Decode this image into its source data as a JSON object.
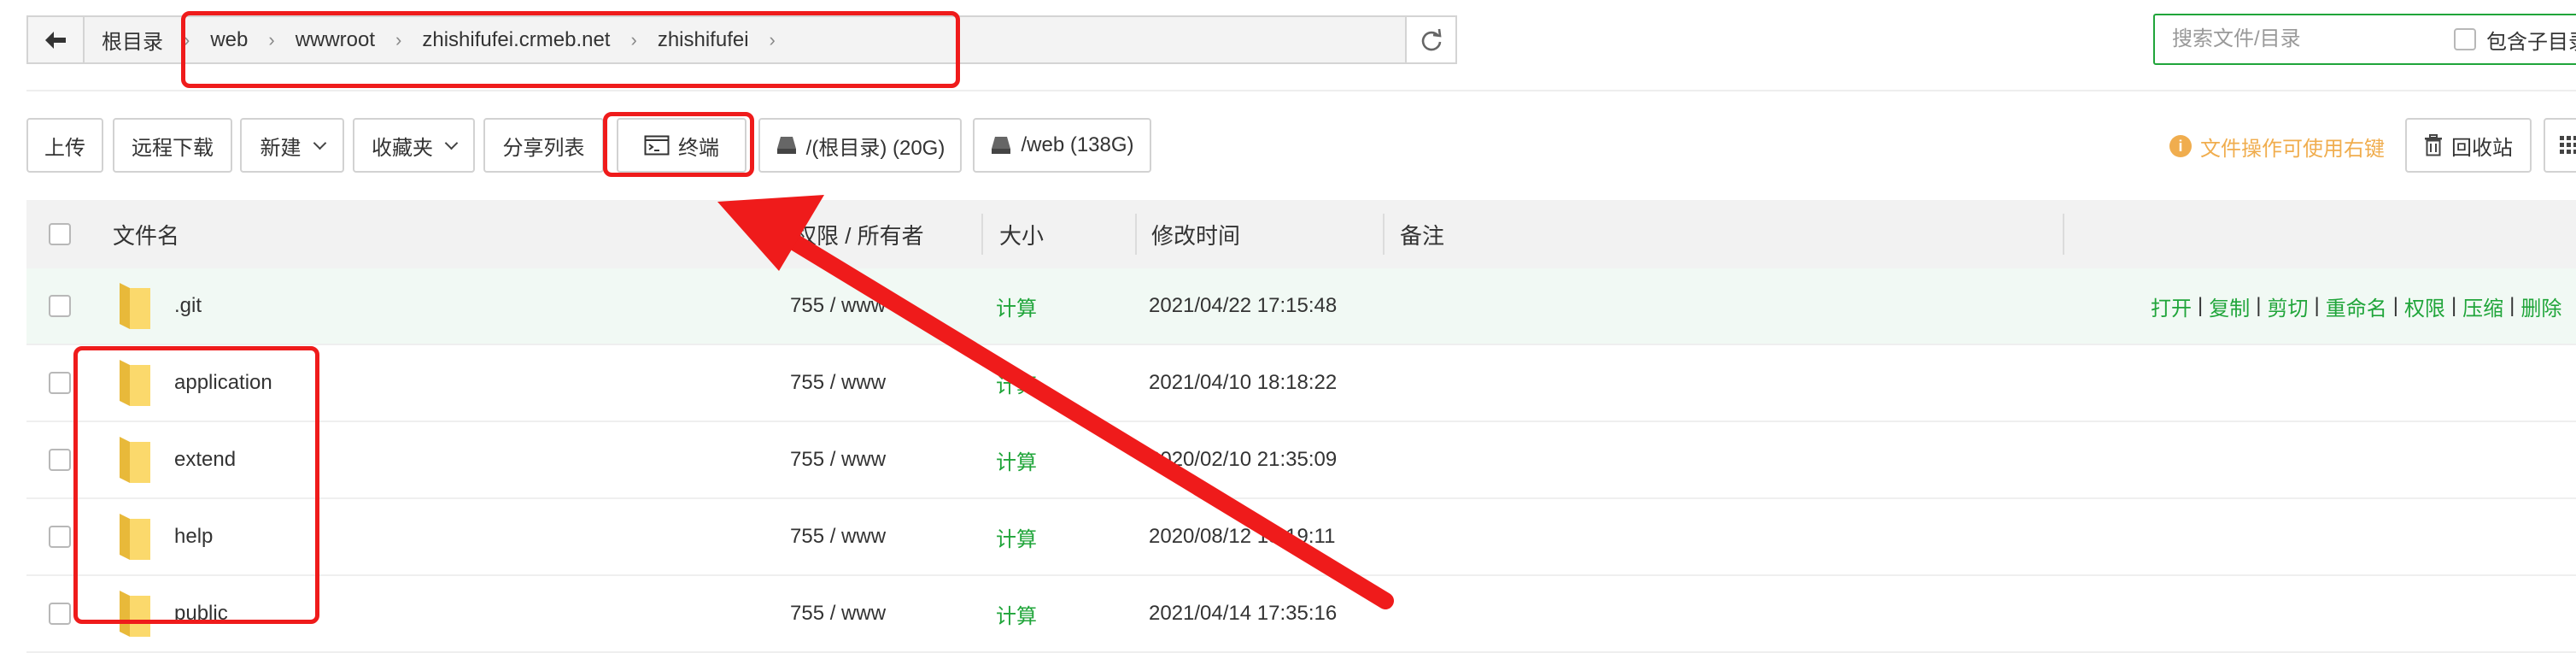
{
  "pathbar": {
    "root": "根目录",
    "crumbs": [
      "web",
      "wwwroot",
      "zhishifufei.crmeb.net",
      "zhishifufei"
    ]
  },
  "search": {
    "placeholder": "搜索文件/目录",
    "subdir_label": "包含子目录"
  },
  "toolbar": {
    "upload": "上传",
    "remote_download": "远程下载",
    "new": "新建",
    "favorites": "收藏夹",
    "share_list": "分享列表",
    "terminal": "终端",
    "disk_root": "/(根目录) (20G)",
    "disk_web": "/web (138G)",
    "tip": "文件操作可使用右键",
    "recycle_bin": "回收站"
  },
  "table": {
    "headers": {
      "name": "文件名",
      "perm": "权限 / 所有者",
      "size": "大小",
      "mtime": "修改时间",
      "note": "备注"
    },
    "rows": [
      {
        "name": ".git",
        "perm": "755 / www",
        "size": "计算",
        "mtime": "2021/04/22 17:15:48"
      },
      {
        "name": "application",
        "perm": "755 / www",
        "size": "计算",
        "mtime": "2021/04/10 18:18:22"
      },
      {
        "name": "extend",
        "perm": "755 / www",
        "size": "计算",
        "mtime": "2020/02/10 21:35:09"
      },
      {
        "name": "help",
        "perm": "755 / www",
        "size": "计算",
        "mtime": "2020/08/12 15:19:11"
      },
      {
        "name": "public",
        "perm": "755 / www",
        "size": "计算",
        "mtime": "2021/04/14 17:35:16"
      }
    ],
    "row_actions": [
      "打开",
      "复制",
      "剪切",
      "重命名",
      "权限",
      "压缩",
      "删除"
    ]
  },
  "colors": {
    "accent": "#20a53a",
    "warning": "#f0ad4e",
    "annotation": "#ef1b1b"
  }
}
